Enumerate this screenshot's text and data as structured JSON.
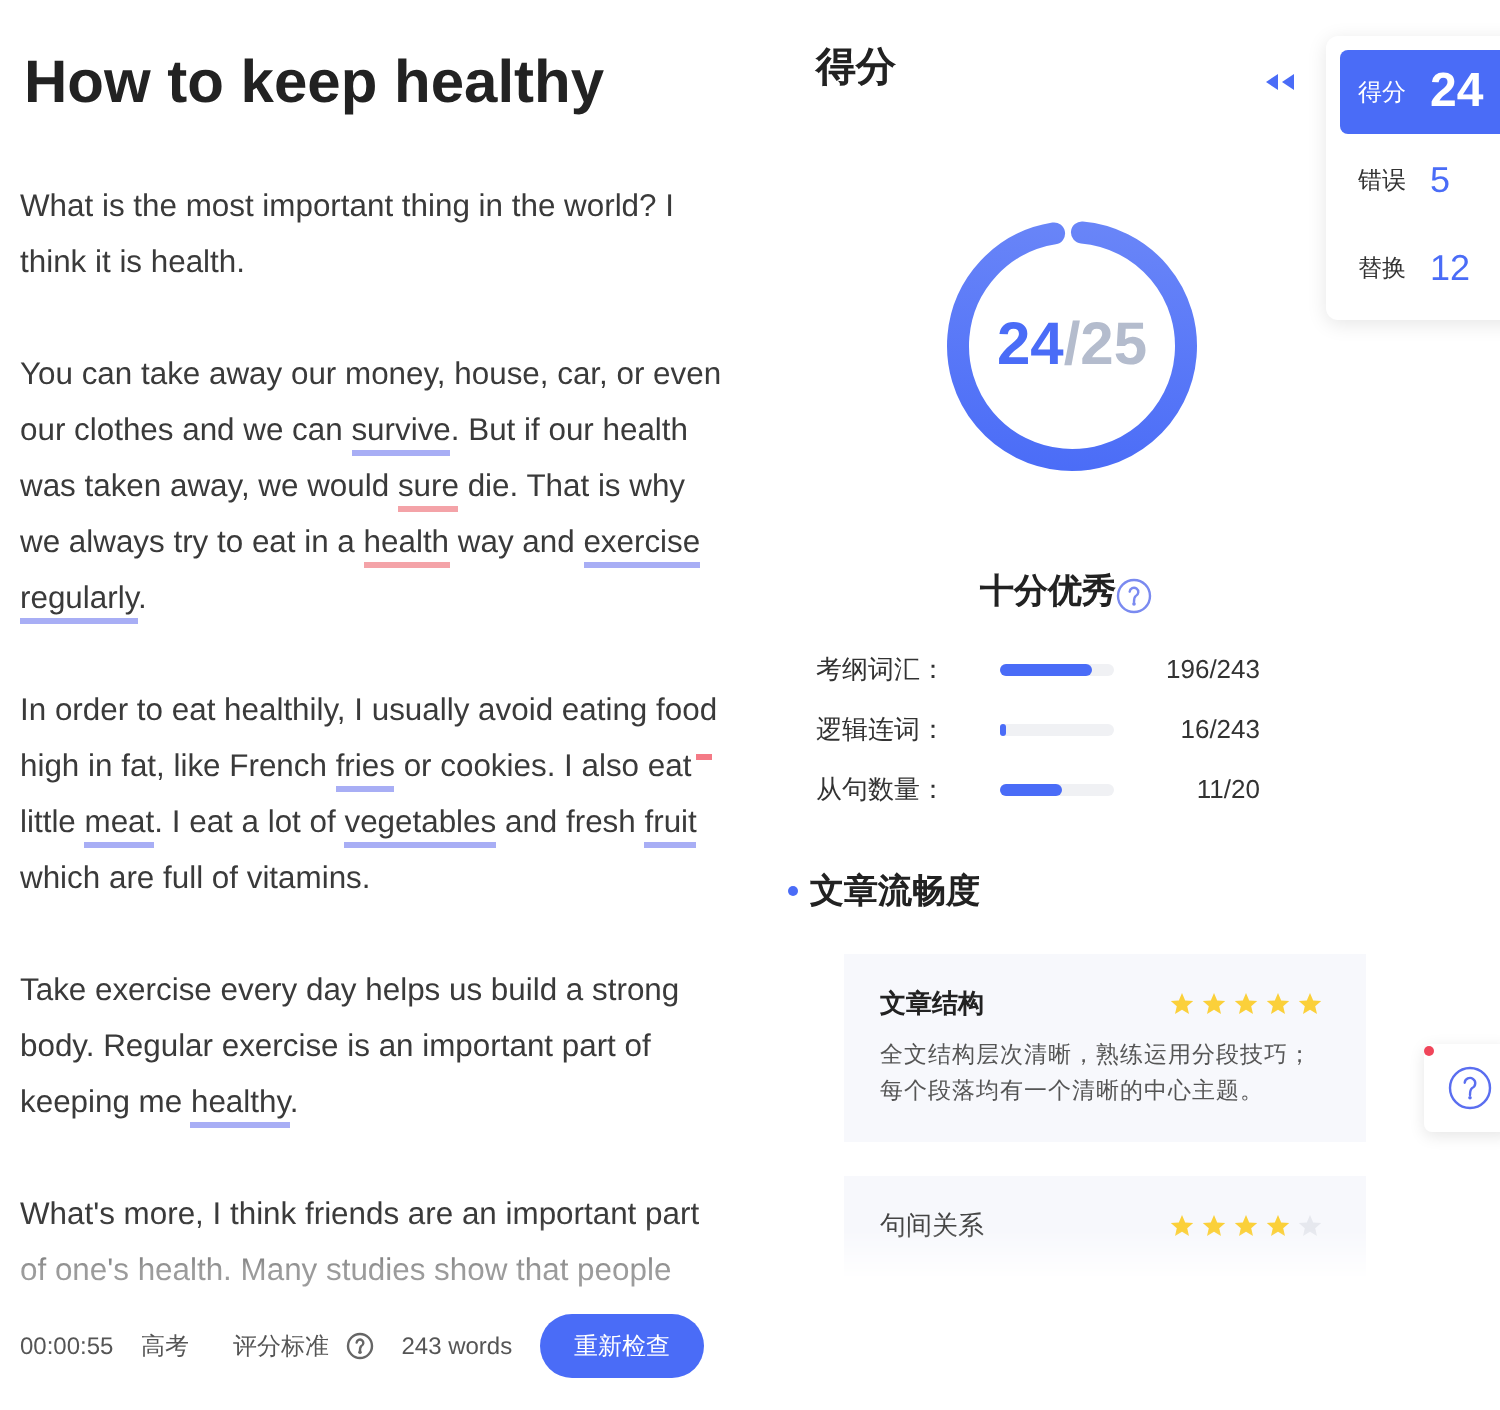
{
  "essay": {
    "title": "How to keep healthy",
    "paragraphs": [
      {
        "segments": [
          {
            "kind": "plain",
            "text": "What is the most important thing in the world? I think it is health."
          }
        ]
      },
      {
        "segments": [
          {
            "kind": "plain",
            "text": "You can take away our money, house, car, or even our clothes and we can "
          },
          {
            "kind": "upgrade",
            "text": "survive"
          },
          {
            "kind": "plain",
            "text": ". But if our health was taken away, we would "
          },
          {
            "kind": "error",
            "text": "sure"
          },
          {
            "kind": "plain",
            "text": " die. That is why we always try to eat in a "
          },
          {
            "kind": "error",
            "text": "health"
          },
          {
            "kind": "plain",
            "text": " way and "
          },
          {
            "kind": "upgrade",
            "text": "exercise"
          },
          {
            "kind": "upgrade",
            "text": "regularly"
          },
          {
            "kind": "plain",
            "text": "."
          }
        ]
      },
      {
        "segments": [
          {
            "kind": "plain",
            "text": "In order to eat healthily, I usually avoid eating food high in fat, like French "
          },
          {
            "kind": "upgrade",
            "text": "fries"
          },
          {
            "kind": "plain",
            "text": " or cookies. I also eat"
          },
          {
            "kind": "missing"
          },
          {
            "kind": "plain",
            "text": " little "
          },
          {
            "kind": "upgrade",
            "text": "meat"
          },
          {
            "kind": "plain",
            "text": ". I eat a lot of "
          },
          {
            "kind": "upgrade",
            "text": "vegetables"
          },
          {
            "kind": "plain",
            "text": " and fresh "
          },
          {
            "kind": "upgrade",
            "text": "fruit"
          },
          {
            "kind": "plain",
            "text": " which are full of vitamins."
          }
        ]
      },
      {
        "segments": [
          {
            "kind": "plain",
            "text": "Take exercise every day helps us build a strong body. Regular exercise is an important part of keeping me "
          },
          {
            "kind": "upgrade",
            "text": "healthy"
          },
          {
            "kind": "plain",
            "text": "."
          }
        ]
      },
      {
        "segments": [
          {
            "kind": "plain",
            "text": "What's more, I think friends are an important part of one's health. Many studies show that people"
          }
        ]
      }
    ]
  },
  "footer": {
    "time": "00:00:55",
    "exam": "高考",
    "criteria": "评分标准",
    "word_count": "243 words",
    "recheck_button": "重新检查"
  },
  "score_panel": {
    "title": "得分",
    "score": "24",
    "total": "/25",
    "level": 0.96,
    "rating": "十分优秀",
    "metrics": [
      {
        "label": "考纲词汇：",
        "level": 0.8,
        "reading": "196/243"
      },
      {
        "label": "逻辑连词：",
        "level": 0.05,
        "reading": "16/243"
      },
      {
        "label": "从句数量：",
        "level": 0.55,
        "reading": "11/20"
      }
    ]
  },
  "fluency": {
    "title": "文章流畅度",
    "cards": [
      {
        "title": "文章结构",
        "stars": 5,
        "text": "全文结构层次清晰，熟练运用分段技巧；每个段落均有一个清晰的中心主题。"
      },
      {
        "title": "句间关系",
        "stars": 4
      }
    ]
  },
  "side_tabs": [
    {
      "label": "得分",
      "value": "24",
      "selected": true
    },
    {
      "label": "错误",
      "value": "5",
      "selected": false
    },
    {
      "label": "替换",
      "value": "12",
      "selected": false
    }
  ],
  "help_button": {
    "notification": true
  }
}
